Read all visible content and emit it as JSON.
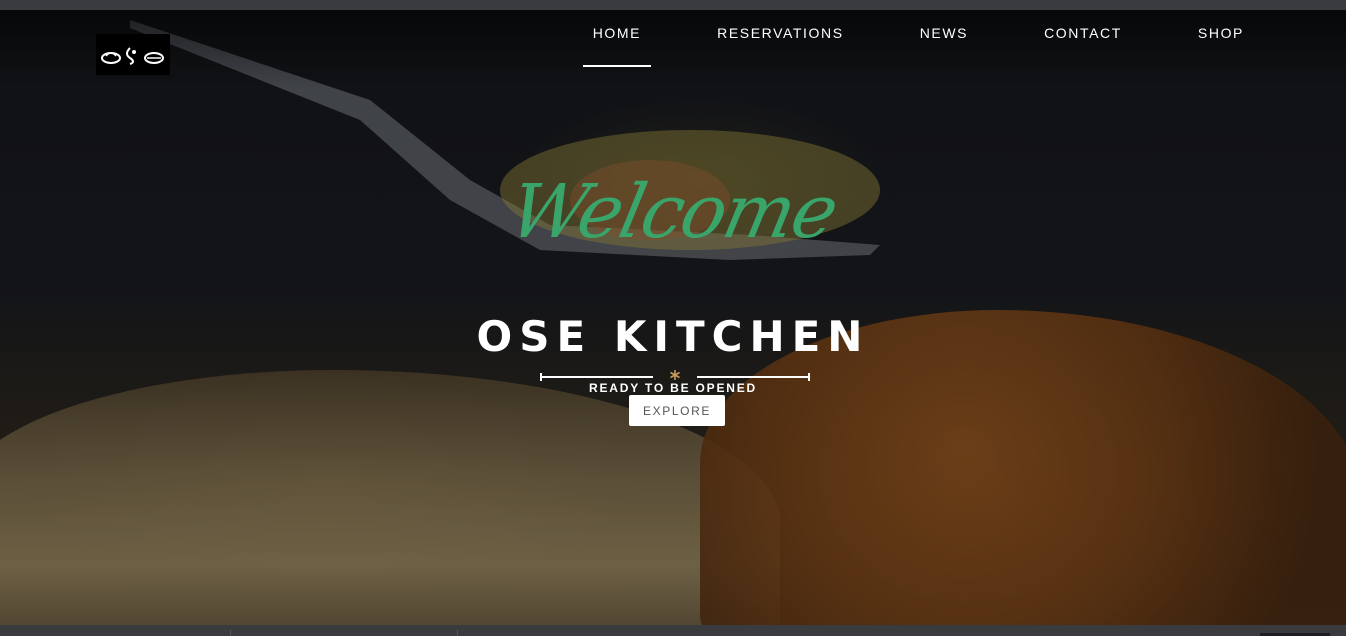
{
  "brand": {
    "logo_alt": "ose"
  },
  "nav": {
    "items": [
      {
        "label": "HOME",
        "active": true
      },
      {
        "label": "RESERVATIONS",
        "active": false
      },
      {
        "label": "NEWS",
        "active": false
      },
      {
        "label": "CONTACT",
        "active": false
      },
      {
        "label": "SHOP",
        "active": false
      }
    ]
  },
  "hero": {
    "script_text": "Welcome",
    "title": "OSE KITCHEN",
    "subtitle": "READY TO BE OPENED",
    "divider_icon": "asterisk-icon",
    "button_label": "EXPLORE"
  },
  "colors": {
    "accent_green": "#3aa56b",
    "divider_accent": "#c99a5a",
    "text_light": "#ffffff"
  }
}
